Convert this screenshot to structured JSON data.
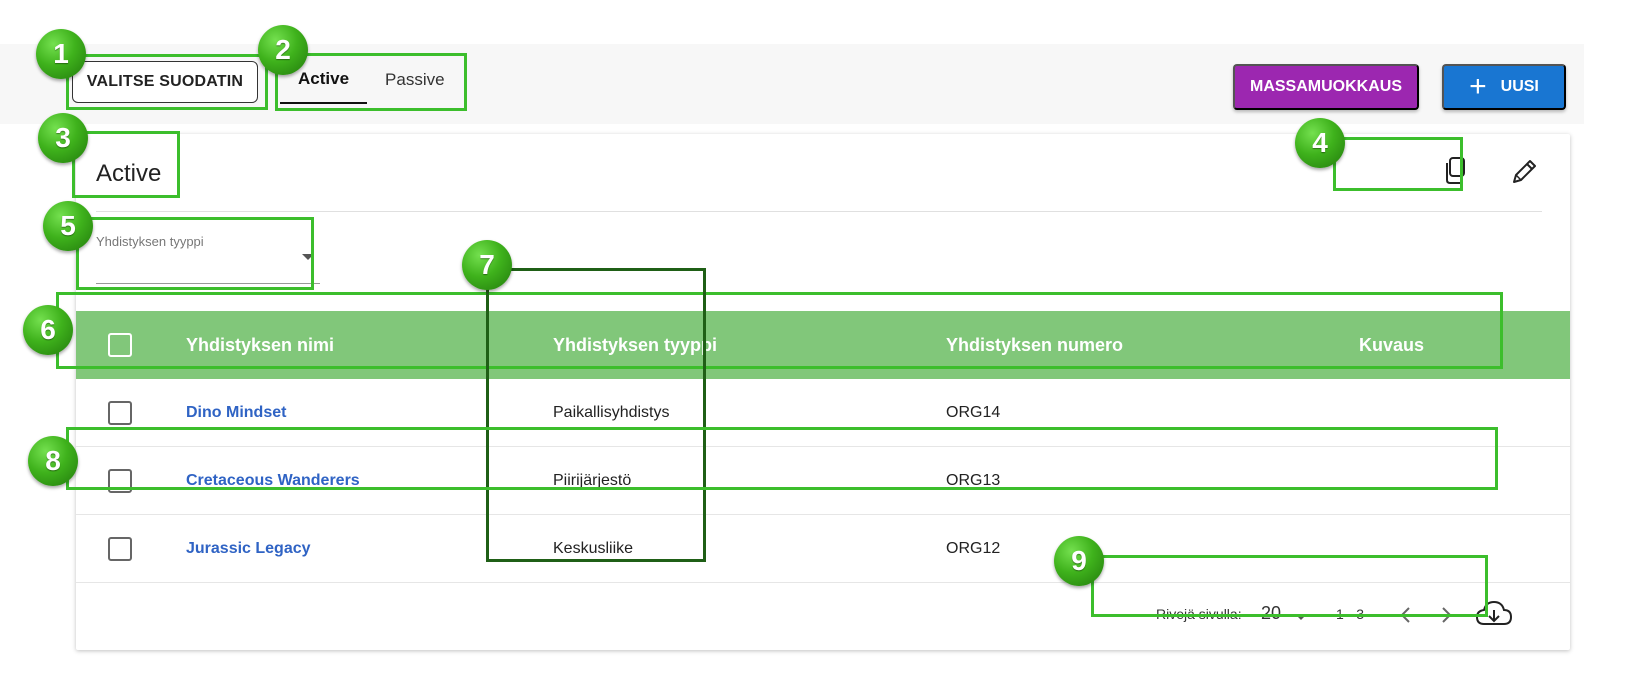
{
  "toolbar": {
    "filter_label": "VALITSE SUODATIN",
    "tabs": [
      {
        "label": "Active",
        "active": true
      },
      {
        "label": "Passive",
        "active": false
      }
    ],
    "mass_edit_label": "MASSAMUOKKAUS",
    "new_label": "UUSI"
  },
  "card": {
    "title": "Active",
    "icons": [
      "copy-icon",
      "pencil-icon"
    ],
    "filter_select": {
      "label": "Yhdistyksen tyyppi",
      "value": ""
    }
  },
  "table": {
    "headers": [
      "Yhdistyksen nimi",
      "Yhdistyksen tyyppi",
      "Yhdistyksen numero",
      "Kuvaus"
    ],
    "rows": [
      {
        "name": "Dino Mindset",
        "type": "Paikallisyhdistys",
        "number": "ORG14",
        "description": ""
      },
      {
        "name": "Cretaceous Wanderers",
        "type": "Piirijärjestö",
        "number": "ORG13",
        "description": ""
      },
      {
        "name": "Jurassic Legacy",
        "type": "Keskusliike",
        "number": "ORG12",
        "description": ""
      }
    ]
  },
  "pagination": {
    "rows_per_page_label": "Rivejä sivulla:",
    "rows_per_page": "20",
    "range": "1 - 3"
  },
  "annotations": [
    "1",
    "2",
    "3",
    "4",
    "5",
    "6",
    "7",
    "8",
    "9"
  ],
  "colors": {
    "mass_edit": "#9c27b0",
    "new_button": "#1976d2",
    "table_header": "#81c77a",
    "link": "#2f63c4",
    "annotation": "#3cbe2c"
  }
}
